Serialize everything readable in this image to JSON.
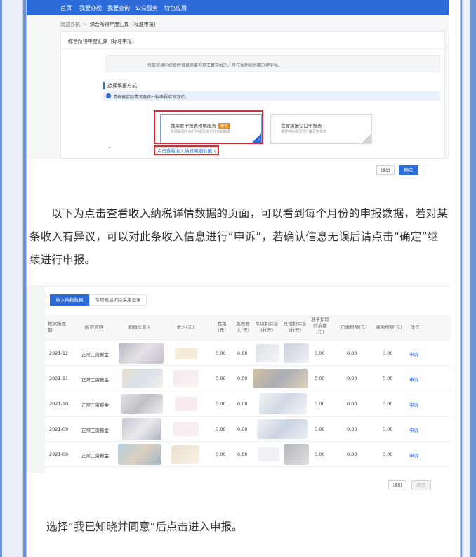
{
  "top_nav": {
    "items": [
      "首页",
      "我要办税",
      "我要查询",
      "公众服务",
      "特色应用"
    ]
  },
  "breadcrumb": {
    "parent": "我要办税",
    "separator": ">",
    "current": "综合所得年度汇算（标准申报）"
  },
  "panel": {
    "title": "综合所得年度汇算（标准申报）",
    "notice": "仅取得境内综合所得且需要办理汇算申报的，可在本功能界面办理申报。",
    "choose_label": "选择填报方式",
    "info": "请根据实际情况选择一种申报填写方式。",
    "options": [
      {
        "title": "我需要申报表预填服务",
        "badge": "推荐",
        "subtitle": "数据来源于自行申报及支付方代扣数据",
        "selected": true
      },
      {
        "title": "我要填报空白申报表",
        "badge": "",
        "subtitle": "根据实际情况自行填写申报表",
        "selected": false
      }
    ],
    "view_link": "点击查看收入纳税明细数据 ∨"
  },
  "footer1": {
    "exit": "退出",
    "ok": "确定"
  },
  "paragraph1": "以下为点击查看收入纳税详情数据的页面，可以看到每个月份的申报数据，若对某条收入有异议，可以对此条收入信息进行“申诉”，若确认信息无误后请点击“确定”继续进行申报。",
  "table": {
    "tabs": [
      "收入纳税数据",
      "专项附加扣除采集记录"
    ],
    "headers": [
      "税款所属期",
      "所得项目",
      "扣缴义务人",
      "收入(元)",
      "费用(元)",
      "免税收入(元)",
      "专项扣除合计(元)",
      "其他扣除合计(元)",
      "准予扣除的捐赠(元)",
      "已缴税额(元)",
      "减免税额(元)",
      "操作"
    ],
    "rows": [
      {
        "period": "2021-12",
        "item": "正常工资薪金",
        "fee": "0.00",
        "exempt": "0.00",
        "donation": "0.00",
        "paid": "0.00",
        "reduce": "0.00",
        "action": "申诉"
      },
      {
        "period": "2021-11",
        "item": "正常工资薪金",
        "fee": "0.00",
        "exempt": "0.00",
        "donation": "0.00",
        "paid": "0.00",
        "reduce": "0.00",
        "action": "申诉"
      },
      {
        "period": "2021-10",
        "item": "正常工资薪金",
        "fee": "0.00",
        "exempt": "0.00",
        "donation": "0.00",
        "paid": "0.00",
        "reduce": "0.00",
        "action": "申诉"
      },
      {
        "period": "2021-09",
        "item": "正常工资薪金",
        "fee": "0.00",
        "exempt": "0.00",
        "donation": "0.00",
        "paid": "0.00",
        "reduce": "0.00",
        "action": "申诉"
      },
      {
        "period": "2021-08",
        "item": "正常工资薪金",
        "fee": "0.00",
        "exempt": "0.00",
        "donation": "0.00",
        "paid": "0.00",
        "reduce": "0.00",
        "action": "申诉"
      }
    ]
  },
  "footer2": {
    "exit": "退出",
    "ok": "确定"
  },
  "paragraph2": "选择“我已知晓并同意”后点击进入申报。",
  "colors": {
    "primary": "#2d6bd9",
    "highlight": "#e0292b",
    "badge": "#f08c1e",
    "frame": "#6e95d3"
  }
}
